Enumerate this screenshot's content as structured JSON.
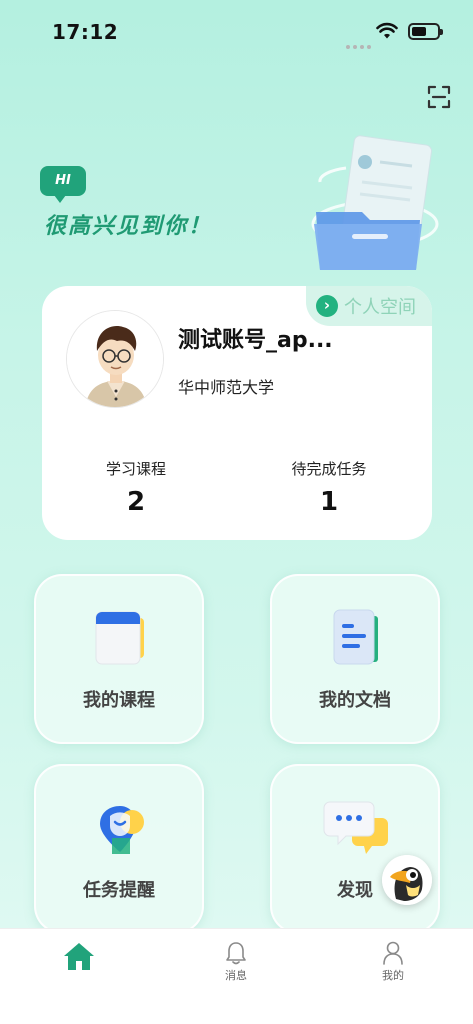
{
  "status_bar": {
    "time": "17:12"
  },
  "hero": {
    "badge": "HI",
    "greeting": "很高兴见到你！"
  },
  "profile": {
    "space_link_label": "个人空间",
    "account_name": "测试账号_ap...",
    "school": "华中师范大学",
    "stats": [
      {
        "label": "学习课程",
        "value": "2"
      },
      {
        "label": "待完成任务",
        "value": "1"
      }
    ]
  },
  "tiles": [
    {
      "label": "我的课程",
      "icon": "courses-book-icon"
    },
    {
      "label": "我的文档",
      "icon": "document-icon"
    },
    {
      "label": "任务提醒",
      "icon": "task-reminder-icon"
    },
    {
      "label": "发现",
      "icon": "discover-chat-icon"
    }
  ],
  "tab_bar": {
    "items": [
      {
        "label": "",
        "icon": "home-icon",
        "active": true
      },
      {
        "label": "消息",
        "icon": "bell-icon",
        "active": false
      },
      {
        "label": "我的",
        "icon": "person-icon",
        "active": false
      }
    ]
  },
  "colors": {
    "accent": "#21a37b",
    "background_top": "#b4f0e0",
    "background_bottom": "#e3faf4"
  }
}
